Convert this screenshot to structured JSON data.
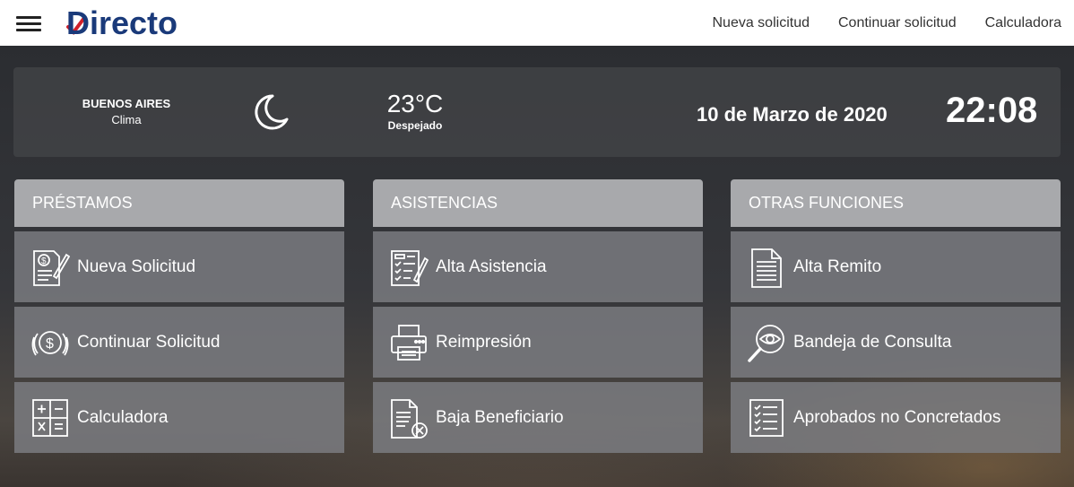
{
  "topbar": {
    "logo_text": "Directo",
    "nav": [
      "Nueva solicitud",
      "Continuar solicitud",
      "Calculadora"
    ]
  },
  "weather": {
    "city": "BUENOS AIRES",
    "label": "Clima",
    "icon": "moon-icon",
    "temperature": "23°C",
    "condition": "Despejado",
    "date": "10 de Marzo de 2020",
    "time": "22:08"
  },
  "columns": [
    {
      "title": "PRÉSTAMOS",
      "items": [
        {
          "label": "Nueva Solicitud",
          "icon": "loan-application-icon"
        },
        {
          "label": "Continuar Solicitud",
          "icon": "continue-money-icon"
        },
        {
          "label": "Calculadora",
          "icon": "calculator-icon"
        }
      ]
    },
    {
      "title": "ASISTENCIAS",
      "items": [
        {
          "label": "Alta Asistencia",
          "icon": "assistance-form-icon"
        },
        {
          "label": "Reimpresión",
          "icon": "printer-icon"
        },
        {
          "label": "Baja Beneficiario",
          "icon": "document-remove-icon"
        }
      ]
    },
    {
      "title": "OTRAS FUNCIONES",
      "items": [
        {
          "label": "Alta Remito",
          "icon": "document-icon"
        },
        {
          "label": "Bandeja de Consulta",
          "icon": "search-eye-icon"
        },
        {
          "label": "Aprobados no Concretados",
          "icon": "checklist-icon"
        }
      ]
    }
  ],
  "colors": {
    "brand": "#1a3a7a",
    "accent_red": "#d0202a",
    "header_tile": "#b2b3b6",
    "item_tile": "#7d7e82"
  }
}
